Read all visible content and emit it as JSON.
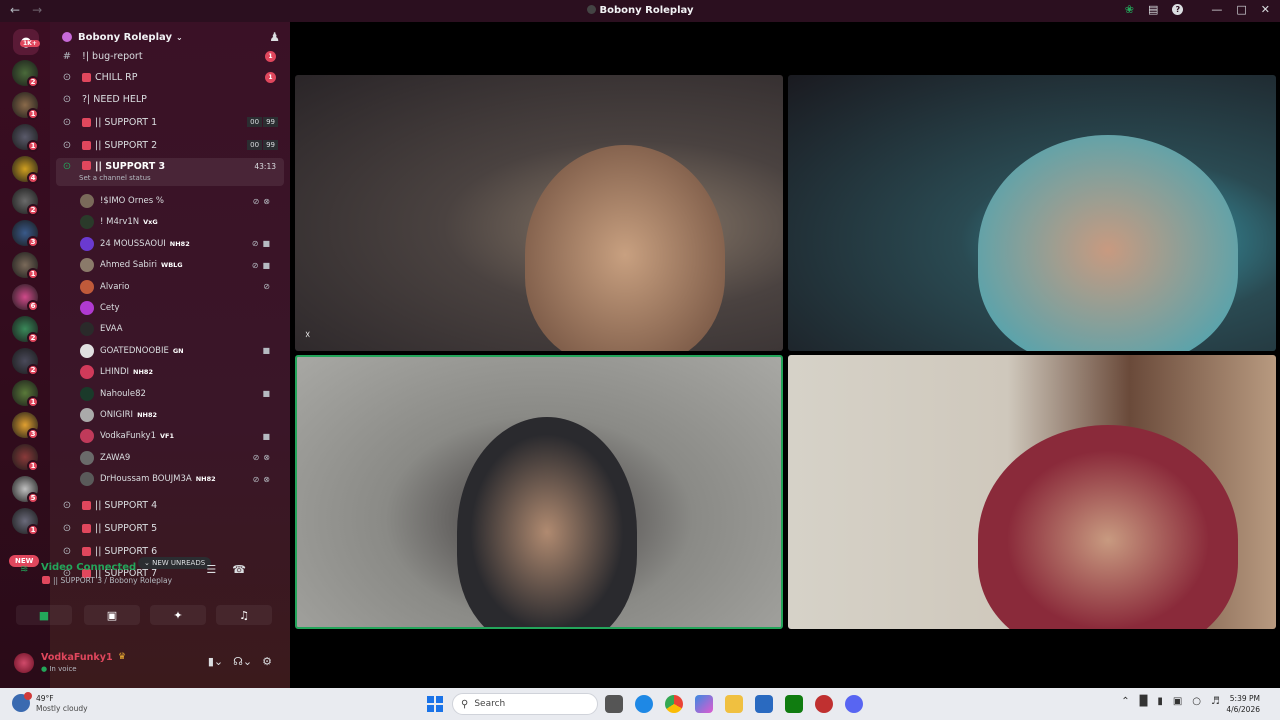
{
  "window": {
    "title": "Bobony Roleplay",
    "nav_back": "←",
    "nav_forward": "→",
    "icons": [
      "leaf-icon",
      "inbox-icon",
      "help-icon",
      "minimize-icon",
      "maximize-icon",
      "close-icon"
    ]
  },
  "rail": {
    "home_badge": "1K+",
    "new_label": "NEW",
    "servers": [
      {
        "badge": "2",
        "color": "#4a6a3a"
      },
      {
        "badge": "1",
        "color": "#8a6a4a"
      },
      {
        "badge": "1",
        "color": "#5a5a6a"
      },
      {
        "badge": "4",
        "color": "#d0a020"
      },
      {
        "badge": "2",
        "color": "#6a6a6a"
      },
      {
        "badge": "3",
        "color": "#3a5a8a"
      },
      {
        "badge": "1",
        "color": "#7a6a5a"
      },
      {
        "badge": "6",
        "color": "#d04a8a"
      },
      {
        "badge": "2",
        "color": "#3a8a5a"
      },
      {
        "badge": "2",
        "color": "#4a4a5a"
      },
      {
        "badge": "1",
        "color": "#5a7a3a"
      },
      {
        "badge": "3",
        "color": "#e0a030"
      },
      {
        "badge": "1",
        "color": "#8a3a3a"
      },
      {
        "badge": "5",
        "color": "#c0c0c0"
      },
      {
        "badge": "1",
        "color": "#6a6a7a"
      }
    ]
  },
  "sidebar": {
    "server_name": "Bobony Roleplay",
    "channels_top": [
      {
        "label": "| bug-report",
        "prefix": "! ",
        "badge": "1"
      },
      {
        "label": "CHILL RP",
        "badge": "1"
      },
      {
        "label": "| NEED HELP",
        "prefix": "? "
      },
      {
        "label": "|| SUPPORT 1",
        "count_a": "00",
        "count_b": "99"
      },
      {
        "label": "|| SUPPORT 2",
        "count_a": "00",
        "count_b": "99"
      }
    ],
    "active_channel": {
      "label": "|| SUPPORT 3",
      "timer": "43:13",
      "status": "Set a channel status"
    },
    "voice_users": [
      {
        "name": "!$IMO Ornes %",
        "badge": "",
        "icons": "mute deafen",
        "color": "#7a6a5a"
      },
      {
        "name": "! M4rv1N",
        "badge": "VxG",
        "icons": "",
        "color": "#2a3a2a"
      },
      {
        "name": "24 MOUSSAOUI",
        "badge": "NH82",
        "icons": "mute video",
        "color": "#6a3ad0"
      },
      {
        "name": "Ahmed Sabiri",
        "badge": "WBLG",
        "icons": "mute video",
        "color": "#8a7a6a"
      },
      {
        "name": "Alvario",
        "badge": "",
        "icons": "mute",
        "color": "#c05a3a"
      },
      {
        "name": "Cety",
        "badge": "",
        "icons": "",
        "color": "#b03ad0"
      },
      {
        "name": "EVAA",
        "badge": "",
        "icons": "",
        "color": "#2a2a2a"
      },
      {
        "name": "GOATEDNOOBIE",
        "badge": "GN",
        "icons": "video",
        "color": "#e0e0e0"
      },
      {
        "name": "LHINDI",
        "badge": "NH82",
        "icons": "",
        "color": "#d03a5a"
      },
      {
        "name": "Nahoule82",
        "badge": "",
        "icons": "video",
        "color": "#1a3a2a"
      },
      {
        "name": "ONIGIRI",
        "badge": "NH82",
        "icons": "",
        "color": "#aaaaaa"
      },
      {
        "name": "VodkaFunky1",
        "badge": "VF1",
        "icons": "video",
        "color": "#c03a5a"
      },
      {
        "name": "ZAWA9",
        "badge": "",
        "icons": "mute deafen",
        "color": "#6a6a6a"
      },
      {
        "name": "DrHoussam BOUJM3A",
        "badge": "NH82",
        "icons": "mute deafen",
        "color": "#5a5a5a"
      }
    ],
    "channels_bottom": [
      {
        "label": "|| SUPPORT 4"
      },
      {
        "label": "|| SUPPORT 5"
      },
      {
        "label": "|| SUPPORT 6"
      },
      {
        "label": "|| SUPPORT 7"
      }
    ],
    "new_unreads": "NEW UNREADS"
  },
  "voice_panel": {
    "title": "Video Connected",
    "subtitle": "|| SUPPORT 3 / Bobony Roleplay"
  },
  "user": {
    "name": "VodkaFunky1",
    "status_prefix": "",
    "status": "In voice"
  },
  "taskbar": {
    "weather_temp": "49°F",
    "weather_desc": "Mostly cloudy",
    "search_placeholder": "Search",
    "time": "5:39 PM",
    "date": "4/6/2026"
  }
}
